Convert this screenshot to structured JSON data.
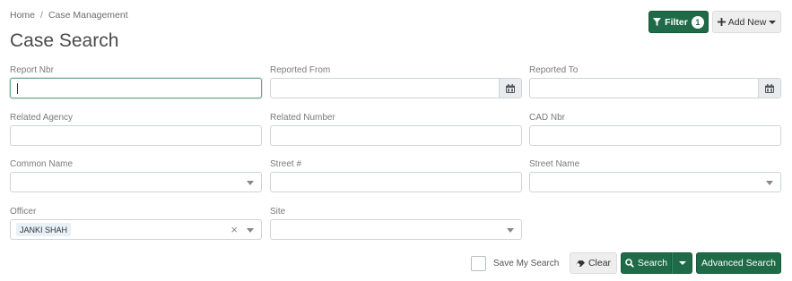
{
  "breadcrumb": {
    "items": [
      "Home",
      "Case Management"
    ],
    "separator": "/"
  },
  "page_title": "Case Search",
  "toolbar": {
    "filter_label": "Filter",
    "filter_count": "1",
    "add_new_label": "Add New"
  },
  "form": {
    "report_nbr": {
      "label": "Report Nbr",
      "value": ""
    },
    "reported_from": {
      "label": "Reported From",
      "value": ""
    },
    "reported_to": {
      "label": "Reported To",
      "value": ""
    },
    "related_agency": {
      "label": "Related Agency",
      "value": ""
    },
    "related_number": {
      "label": "Related Number",
      "value": ""
    },
    "cad_nbr": {
      "label": "CAD Nbr",
      "value": ""
    },
    "common_name": {
      "label": "Common Name",
      "value": ""
    },
    "street_num": {
      "label": "Street #",
      "value": ""
    },
    "street_name": {
      "label": "Street Name",
      "value": ""
    },
    "officer": {
      "label": "Officer",
      "selected": "JANKI SHAH"
    },
    "site": {
      "label": "Site",
      "value": ""
    }
  },
  "actions": {
    "save_search_label": "Save My Search",
    "clear_label": "Clear",
    "search_label": "Search",
    "advanced_search_label": "Advanced Search"
  },
  "colors": {
    "primary_green": "#1f6b47",
    "focus_border": "#6aa58a"
  },
  "icons": [
    "filter-icon",
    "plus-icon",
    "calendar-icon",
    "eraser-icon",
    "search-icon",
    "chevron-down-icon",
    "close-icon"
  ]
}
